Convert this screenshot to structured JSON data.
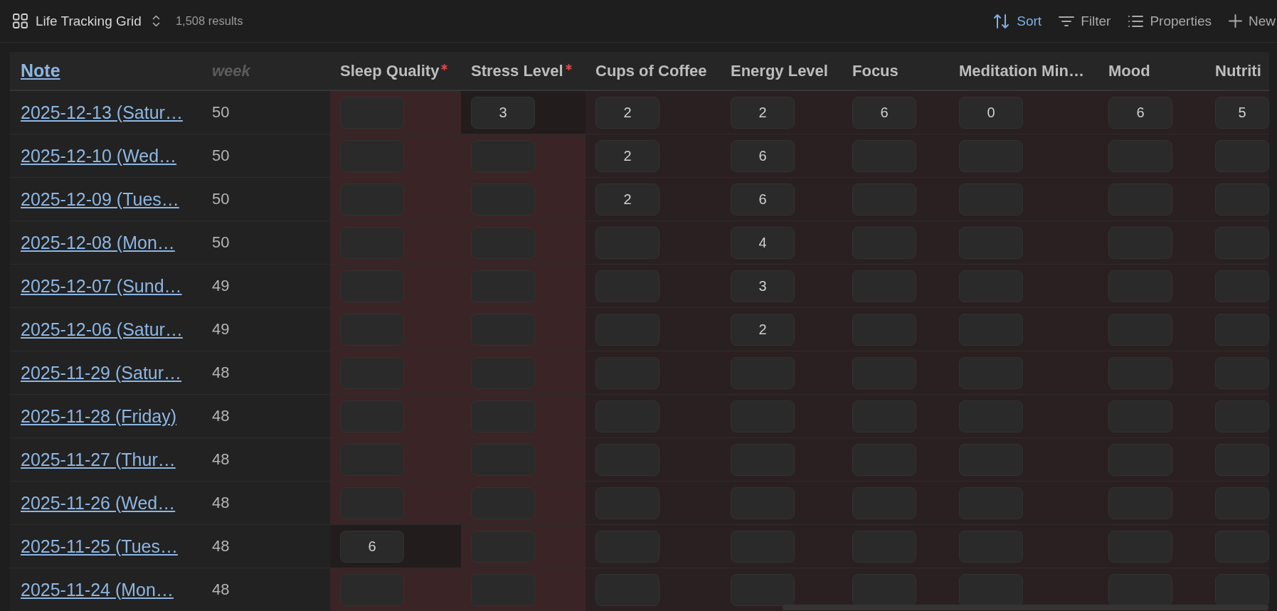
{
  "view": {
    "title": "Life Tracking Grid",
    "count": "1,508 results"
  },
  "toolbar": [
    {
      "kind": "sort",
      "label": "Sort",
      "active": true
    },
    {
      "kind": "filter",
      "label": "Filter",
      "active": false
    },
    {
      "kind": "properties",
      "label": "Properties",
      "active": false
    },
    {
      "kind": "new",
      "label": "New",
      "active": false
    }
  ],
  "table": {
    "columns": [
      {
        "label": "Note",
        "kind": "link"
      },
      {
        "label": "week",
        "kind": "formula"
      },
      {
        "label": "Sleep Quality",
        "kind": "number",
        "required": true
      },
      {
        "label": "Stress Level",
        "kind": "number",
        "required": true
      },
      {
        "label": "Cups of Coffee",
        "kind": "number",
        "required": false
      },
      {
        "label": "Energy Level",
        "kind": "number",
        "required": false
      },
      {
        "label": "Focus",
        "kind": "number",
        "required": false
      },
      {
        "label": "Meditation Min…",
        "kind": "number",
        "required": false
      },
      {
        "label": "Mood",
        "kind": "number",
        "required": false
      },
      {
        "label": "Nutriti",
        "kind": "number",
        "required": false
      }
    ],
    "rows": [
      {
        "cells": [
          "2025-12-13 (Satur…",
          "50",
          null,
          "3",
          "2",
          "2",
          "6",
          "0",
          "6",
          "5"
        ]
      },
      {
        "cells": [
          "2025-12-10 (Wed…",
          "50",
          null,
          null,
          "2",
          "6",
          null,
          null,
          null,
          null
        ]
      },
      {
        "cells": [
          "2025-12-09 (Tues…",
          "50",
          null,
          null,
          "2",
          "6",
          null,
          null,
          null,
          null
        ]
      },
      {
        "cells": [
          "2025-12-08 (Mon…",
          "50",
          null,
          null,
          null,
          "4",
          null,
          null,
          null,
          null
        ]
      },
      {
        "cells": [
          "2025-12-07 (Sund…",
          "49",
          null,
          null,
          null,
          "3",
          null,
          null,
          null,
          null
        ]
      },
      {
        "cells": [
          "2025-12-06 (Satur…",
          "49",
          null,
          null,
          null,
          "2",
          null,
          null,
          null,
          null
        ]
      },
      {
        "cells": [
          "2025-11-29 (Satur…",
          "48",
          null,
          null,
          null,
          null,
          null,
          null,
          null,
          null
        ]
      },
      {
        "cells": [
          "2025-11-28 (Friday)",
          "48",
          null,
          null,
          null,
          null,
          null,
          null,
          null,
          null
        ]
      },
      {
        "cells": [
          "2025-11-27 (Thur…",
          "48",
          null,
          null,
          null,
          null,
          null,
          null,
          null,
          null
        ]
      },
      {
        "cells": [
          "2025-11-26 (Wed…",
          "48",
          null,
          null,
          null,
          null,
          null,
          null,
          null,
          null
        ]
      },
      {
        "cells": [
          "2025-11-25 (Tues…",
          "48",
          "6",
          null,
          null,
          null,
          null,
          null,
          null,
          null
        ]
      },
      {
        "cells": [
          "2025-11-24 (Mon…",
          "48",
          null,
          null,
          null,
          null,
          null,
          null,
          null,
          null
        ]
      }
    ]
  }
}
